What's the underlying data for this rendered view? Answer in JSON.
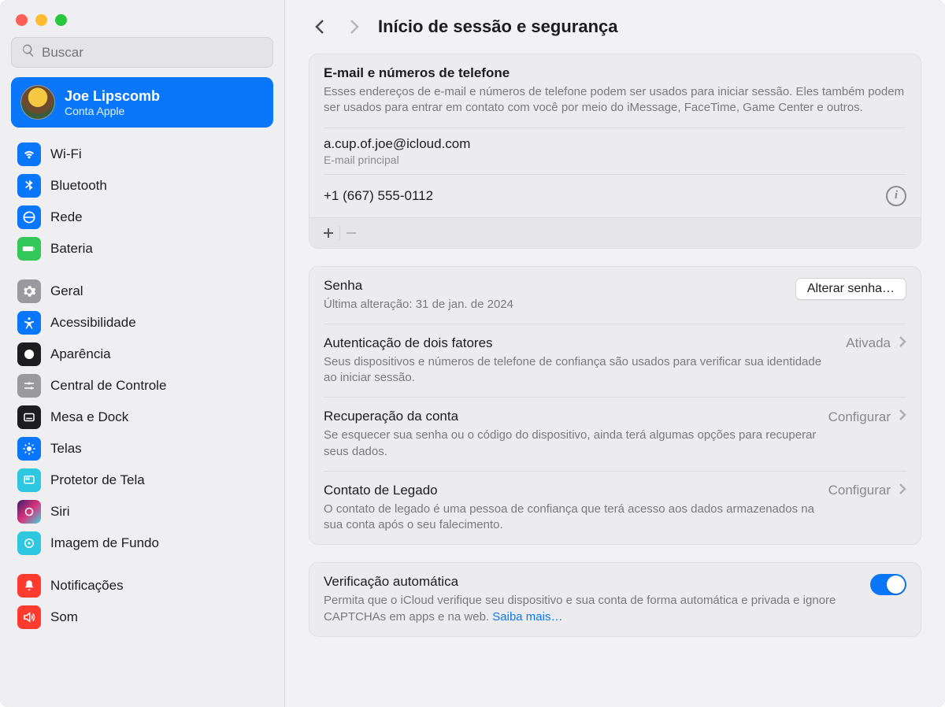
{
  "search": {
    "placeholder": "Buscar"
  },
  "user": {
    "name": "Joe Lipscomb",
    "subtitle": "Conta Apple"
  },
  "sidebar": {
    "group1": [
      {
        "label": "Wi-Fi",
        "color": "#0a77fb"
      },
      {
        "label": "Bluetooth",
        "color": "#0a77fb"
      },
      {
        "label": "Rede",
        "color": "#0a77fb"
      },
      {
        "label": "Bateria",
        "color": "#34c759"
      }
    ],
    "group2": [
      {
        "label": "Geral",
        "color": "#9a999e"
      },
      {
        "label": "Acessibilidade",
        "color": "#0a77fb"
      },
      {
        "label": "Aparência",
        "color": "#1d1d1f"
      },
      {
        "label": "Central de Controle",
        "color": "#9a999e"
      },
      {
        "label": "Mesa e Dock",
        "color": "#1d1d1f"
      },
      {
        "label": "Telas",
        "color": "#0a77fb"
      },
      {
        "label": "Protetor de Tela",
        "color": "#2dc8e0"
      },
      {
        "label": "Siri",
        "color": "#1d1d1f"
      },
      {
        "label": "Imagem de Fundo",
        "color": "#2dc8e0"
      }
    ],
    "group3": [
      {
        "label": "Notificações",
        "color": "#ff3b30"
      },
      {
        "label": "Som",
        "color": "#ff3b30"
      }
    ]
  },
  "header": {
    "title": "Início de sessão e segurança"
  },
  "email_section": {
    "title": "E-mail e números de telefone",
    "desc": "Esses endereços de e-mail e números de telefone podem ser usados para iniciar sessão. Eles também podem ser usados para entrar em contato com você por meio do iMessage, FaceTime, Game Center e outros.",
    "email": "a.cup.of.joe@icloud.com",
    "email_sub": "E-mail principal",
    "phone": "+1 (667) 555-0112"
  },
  "password": {
    "title": "Senha",
    "subtitle": "Última alteração: 31 de jan. de 2024",
    "button": "Alterar senha…"
  },
  "twofa": {
    "title": "Autenticação de dois fatores",
    "desc": "Seus dispositivos e números de telefone de confiança são usados para verificar sua identidade ao iniciar sessão.",
    "status": "Ativada"
  },
  "recovery": {
    "title": "Recuperação da conta",
    "desc": "Se esquecer sua senha ou o código do dispositivo, ainda terá algumas opções para recuperar seus dados.",
    "action": "Configurar"
  },
  "legacy": {
    "title": "Contato de Legado",
    "desc": "O contato de legado é uma pessoa de confiança que terá acesso aos dados armazenados na sua conta após o seu falecimento.",
    "action": "Configurar"
  },
  "autoverify": {
    "title": "Verificação automática",
    "desc": "Permita que o iCloud verifique seu dispositivo e sua conta de forma automática e privada e ignore CAPTCHAs em apps e na web. ",
    "link": "Saiba mais…"
  }
}
